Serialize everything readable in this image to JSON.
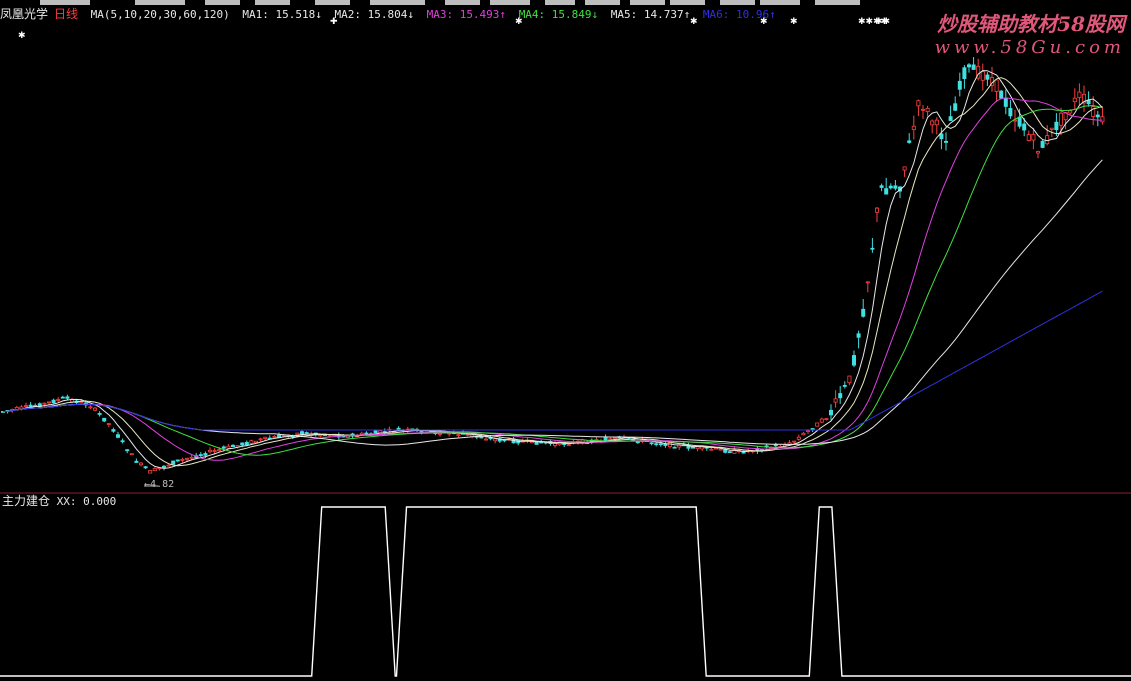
{
  "header": {
    "stock_name": "凤凰光学",
    "period": "日线",
    "ma_params": "MA(5,10,20,30,60,120)",
    "ma_items": [
      {
        "label": "MA1: 15.518↓",
        "color": "#e8e8e8"
      },
      {
        "label": "MA2: 15.804↓",
        "color": "#e8e8e8"
      },
      {
        "label": "MA3: 15.493↑",
        "color": "#e040e0"
      },
      {
        "label": "MA4: 15.849↓",
        "color": "#40e040"
      },
      {
        "label": "MA5: 14.737↑",
        "color": "#e8e8e8"
      },
      {
        "label": "MA6: 10.96↑",
        "color": "#3030e0"
      }
    ]
  },
  "watermark": {
    "line1_a": "炒股辅助教材",
    "line1_b": "58股网",
    "line2": "www.58Gu.com"
  },
  "main_chart": {
    "low_label": "4.82",
    "event_markers": [
      "✱",
      "✚",
      "✱",
      "✱",
      "✱",
      "✱",
      "✱✱✱✱",
      "✱✱"
    ]
  },
  "sub_chart": {
    "indicator_name": "主力建仓",
    "value_label": "XX: 0.000",
    "signal": [
      {
        "from": 0,
        "to": 0.28,
        "value": 0
      },
      {
        "from": 0.28,
        "to": 0.345,
        "value": 1
      },
      {
        "from": 0.345,
        "to": 0.355,
        "value": 0
      },
      {
        "from": 0.355,
        "to": 0.62,
        "value": 1
      },
      {
        "from": 0.62,
        "to": 0.72,
        "value": 0
      },
      {
        "from": 0.72,
        "to": 0.74,
        "value": 1
      },
      {
        "from": 0.74,
        "to": 1,
        "value": 0
      }
    ]
  },
  "colors": {
    "background": "#000000",
    "divider": "#8a1f2e",
    "up_candle": "#ff4040",
    "down_candle": "#40e0e0",
    "ma1": "#e8e8e8",
    "ma2": "#e8e8c0",
    "ma3": "#e040e0",
    "ma4": "#40e040",
    "ma5": "#e8e8e8",
    "ma6": "#3030e0",
    "signal_line": "#ffffff"
  }
}
